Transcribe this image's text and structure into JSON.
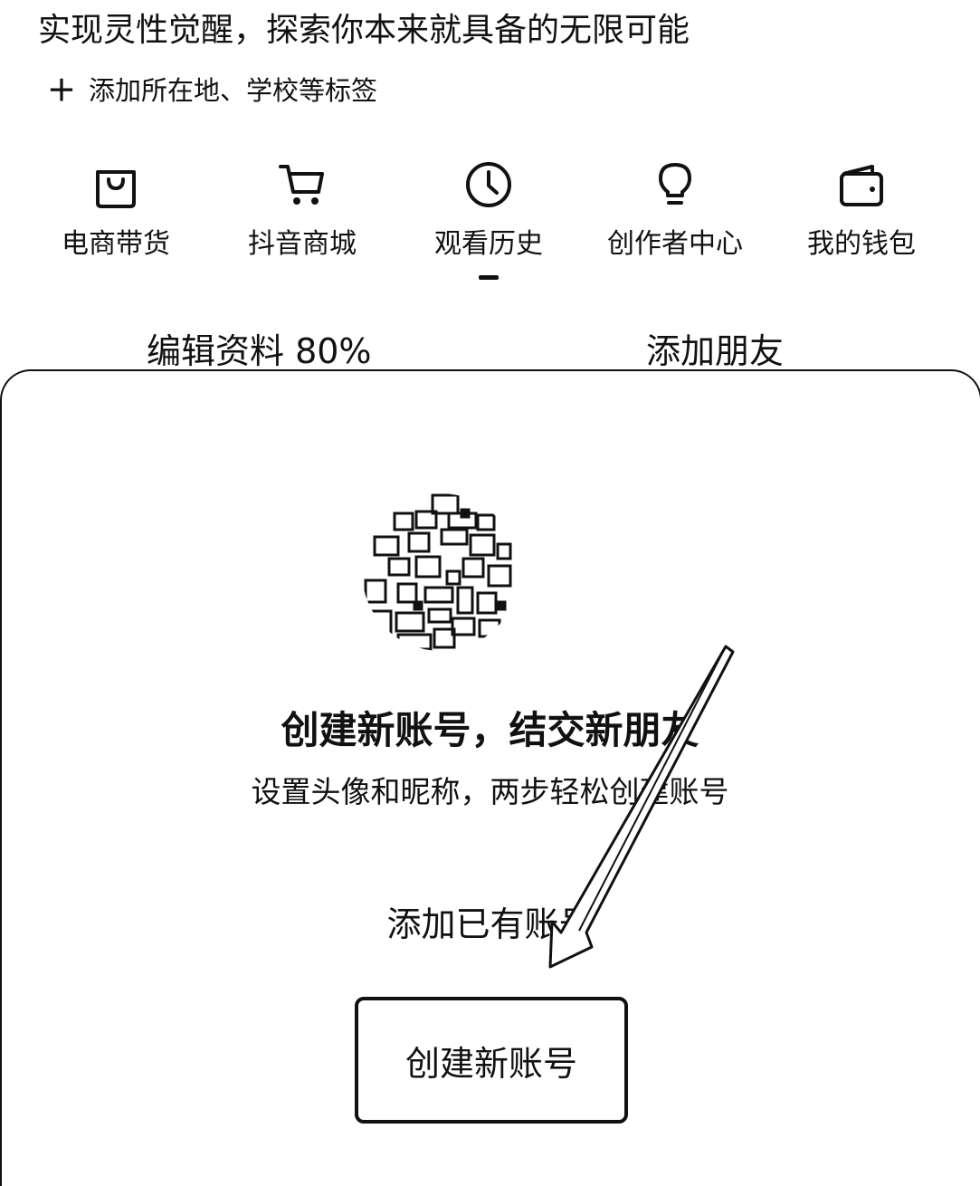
{
  "profile": {
    "bio": "实现灵性觉醒，探索你本来就具备的无限可能",
    "add_tags": {
      "icon": "plus-icon",
      "plus_glyph": "＋",
      "label": "添加所在地、学校等标签"
    }
  },
  "services": [
    {
      "icon": "shopping-bag-icon",
      "label": "电商带货"
    },
    {
      "icon": "shopping-cart-icon",
      "label": "抖音商城"
    },
    {
      "icon": "clock-icon",
      "label": "观看历史",
      "active": true
    },
    {
      "icon": "lightbulb-icon",
      "label": "创作者中心"
    },
    {
      "icon": "wallet-icon",
      "label": "我的钱包"
    }
  ],
  "profile_actions": {
    "edit_profile": "编辑资料 80%",
    "add_friends": "添加朋友"
  },
  "account_sheet": {
    "title": "创建新账号，结交新朋友",
    "subtitle": "设置头像和昵称，两步轻松创建账号",
    "add_existing_label": "添加已有账号",
    "create_button_label": "创建新账号"
  },
  "colors": {
    "text": "#111111",
    "background": "#ffffff",
    "border": "#111111"
  }
}
